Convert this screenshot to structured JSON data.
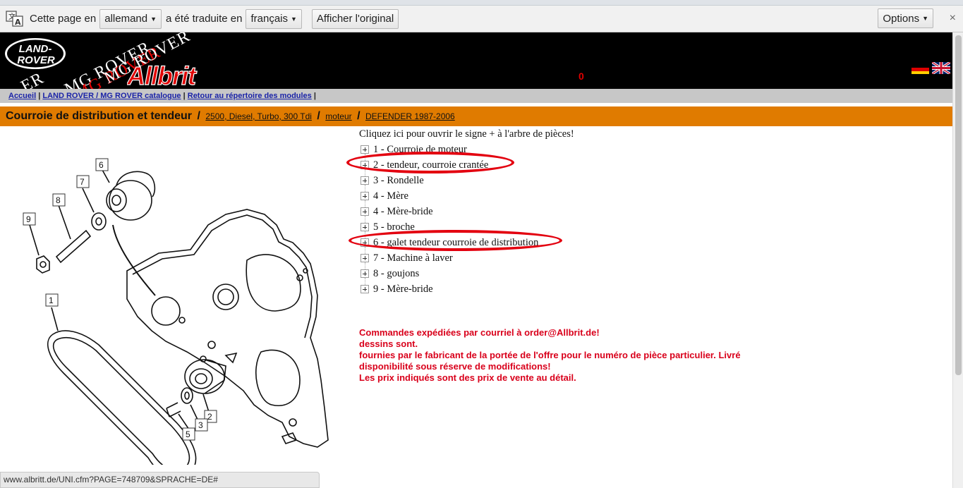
{
  "translate_bar": {
    "page_in": "Cette page en",
    "source_language": "allemand",
    "translated_to": "a été traduite en",
    "target_language": "français",
    "show_original": "Afficher l'original",
    "options": "Options",
    "close": "×"
  },
  "header": {
    "logo_line1": "LAND-",
    "logo_line2": "ROVER",
    "mg_rover_1": "MG ROVER",
    "mg_rover_2": "MG ROVER",
    "mg_rover_3": "MG ROVER",
    "mg_rover_4": "ER",
    "brand": "Allbrit",
    "cart_count": "0",
    "colors": {
      "background": "#000000",
      "brand_red": "#e00000"
    }
  },
  "nav": {
    "home": "Accueil",
    "catalogue": "LAND ROVER / MG ROVER catalogue",
    "back": "Retour au répertoire des modules",
    "sep": "|"
  },
  "title_bar": {
    "title": "Courroie de distribution et tendeur",
    "sep": "/",
    "crumb1": "2500, Diesel, Turbo, 300 Tdi",
    "crumb2": "moteur",
    "crumb3": "DEFENDER 1987-2006",
    "color": "#e07b00"
  },
  "diagram": {
    "callouts": [
      "6",
      "7",
      "8",
      "9",
      "1",
      "2",
      "3",
      "5"
    ]
  },
  "parts": {
    "intro": "Cliquez ici pour ouvrir le signe + à l'arbre de pièces!",
    "items": [
      {
        "label": "1 - Courroie de moteur"
      },
      {
        "label": "2 - tendeur, courroie crantée"
      },
      {
        "label": "3 - Rondelle"
      },
      {
        "label": "4 - Mère"
      },
      {
        "label": "4 - Mère-bride"
      },
      {
        "label": "5 - broche"
      },
      {
        "label": "6 - galet tendeur courroie de distribution"
      },
      {
        "label": "7 - Machine à laver"
      },
      {
        "label": "8 - goujons"
      },
      {
        "label": "9 - Mère-bride"
      }
    ]
  },
  "notes": {
    "line1": "Commandes expédiées par courriel à order@Allbrit.de!",
    "line2": "dessins sont.",
    "line3": "fournies par le fabricant de la portée de l'offre pour le numéro de pièce particulier. Livré",
    "line4": "disponibilité sous réserve de modifications!",
    "line5": "Les prix indiqués sont des prix de vente au détail.",
    "color": "#d9001b"
  },
  "status_url": "www.albritt.de/UNI.cfm?PAGE=748709&SPRACHE=DE#"
}
